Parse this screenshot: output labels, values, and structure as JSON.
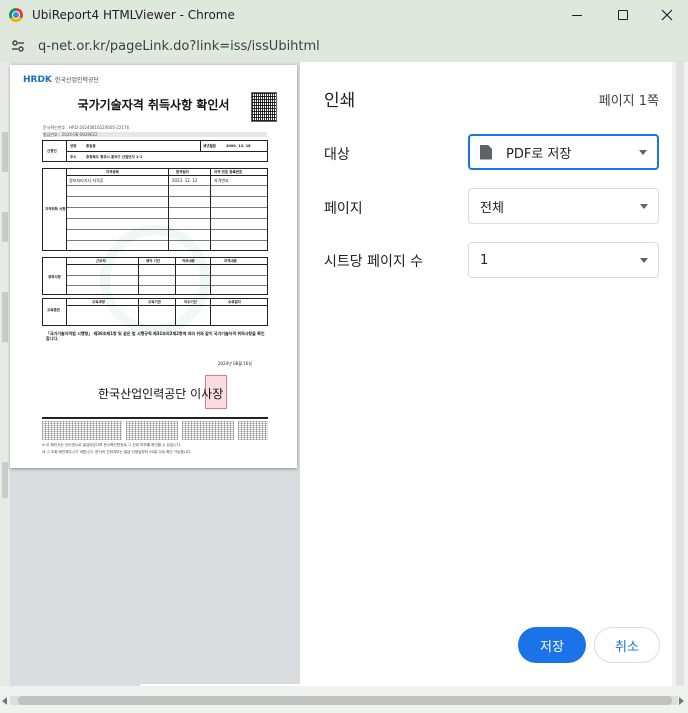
{
  "window": {
    "title": "UbiReport4 HTMLViewer - Chrome",
    "url": "q-net.or.kr/pageLink.do?link=iss/issUbihtml"
  },
  "print": {
    "title": "인쇄",
    "page_count": "페이지 1쪽",
    "rows": [
      {
        "label": "대상",
        "value": "PDF로 저장",
        "icon": "document-icon"
      },
      {
        "label": "페이지",
        "value": "전체"
      },
      {
        "label": "시트당 페이지 수",
        "value": "1"
      }
    ],
    "save_button": "저장",
    "cancel_button": "취소"
  },
  "colors": {
    "accent": "#1a73e8",
    "titlebar": "#dfe8dd"
  },
  "document": {
    "logo": "HRDK",
    "logo_org": "한국산업인력공단",
    "title": "국가기술자격 취득사항 확인서",
    "doc_number": "문서확인번호 : HRD-20240816220605-22176",
    "issue_number": "발급번호 : 2024-08-0828622",
    "sections": {
      "person": "신청인",
      "person_name_label": "성명",
      "person_name": "홍길동",
      "birth_label": "생년월일",
      "birth_value": "2000. 12. 18",
      "address_label": "주소",
      "address": "충청북도 청주시 흥덕구 산업단지 1-1",
      "qualification": "자격취득 사항",
      "qual_headers": [
        "자격종목",
        "합격일자",
        "자격 번호 등록번호"
      ],
      "qual_row": [
        "정보처리기사 자격증",
        "2023. 12. 12",
        "자격번호"
      ],
      "career": "경력사항",
      "career_headers": [
        "근무처",
        "재직 기간",
        "직무내용",
        "자격내용"
      ],
      "training": "교육훈련",
      "training_headers": [
        "교육과정",
        "교육기관",
        "이수기간",
        "수료일자"
      ]
    },
    "statement": "「국가기술자격법 시행령」 제38조제1항 및 같은 법 시행규칙 제31조의2제2항에 따라 위와 같이 국가기술자격 취득사항을 확인합니다.",
    "date": "2024년 08월 16일",
    "issuer": "한국산업인력공단 이사장",
    "footer1": "※ 이 확인서는 인터넷으로 발급되었으며 문서확인번호로 그 진위 여부를 확인할 수 있습니다.",
    "footer2": "내 그 조회 확인해주시기 바랍니다. 문서의 진위여부는 발급 신청일부터 90일 이내 확인 가능합니다."
  }
}
